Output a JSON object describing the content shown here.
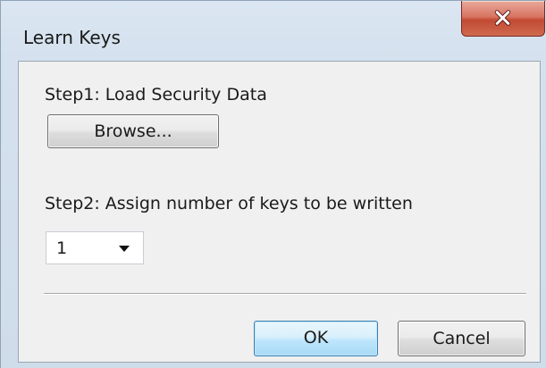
{
  "window": {
    "title": "Learn Keys",
    "close_symbol": "X"
  },
  "step1": {
    "label": "Step1:  Load Security Data",
    "button_label": "Browse..."
  },
  "step2": {
    "label": "Step2:  Assign number of keys to be written",
    "selected_value": "1"
  },
  "footer": {
    "ok_label": "OK",
    "cancel_label": "Cancel"
  },
  "icons": {
    "close": "close-icon",
    "dropdown": "chevron-down-icon"
  },
  "colors": {
    "close_button_red": "#c24a33",
    "ok_button_blue": "#3c7fb1",
    "window_frame": "#d5e1ee",
    "dialog_body": "#f0f0f0"
  }
}
